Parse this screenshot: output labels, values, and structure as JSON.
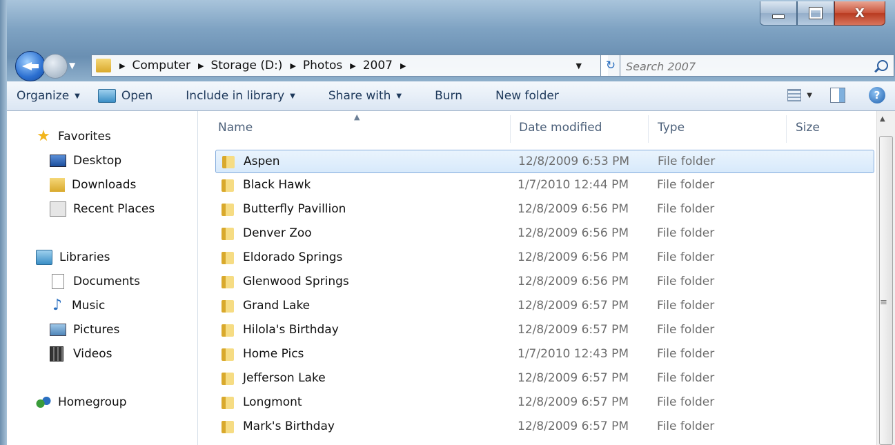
{
  "window": {
    "caption_buttons": [
      "minimize-icon",
      "maximize-icon",
      "close-icon"
    ],
    "close_glyph": "X"
  },
  "address": {
    "crumbs": [
      "Computer",
      "Storage (D:)",
      "Photos",
      "2007"
    ],
    "search_placeholder": "Search 2007"
  },
  "toolbar": {
    "organize": "Organize",
    "open": "Open",
    "include": "Include in library",
    "share": "Share with",
    "burn": "Burn",
    "new_folder": "New folder"
  },
  "nav": {
    "favorites": "Favorites",
    "desktop": "Desktop",
    "downloads": "Downloads",
    "recent": "Recent Places",
    "libraries": "Libraries",
    "documents": "Documents",
    "music": "Music",
    "pictures": "Pictures",
    "videos": "Videos",
    "homegroup": "Homegroup"
  },
  "columns": {
    "name": "Name",
    "date": "Date modified",
    "type": "Type",
    "size": "Size"
  },
  "files": [
    {
      "name": "Aspen",
      "date": "12/8/2009 6:53 PM",
      "type": "File folder"
    },
    {
      "name": "Black Hawk",
      "date": "1/7/2010 12:44 PM",
      "type": "File folder"
    },
    {
      "name": "Butterfly Pavillion",
      "date": "12/8/2009 6:56 PM",
      "type": "File folder"
    },
    {
      "name": "Denver Zoo",
      "date": "12/8/2009 6:56 PM",
      "type": "File folder"
    },
    {
      "name": "Eldorado Springs",
      "date": "12/8/2009 6:56 PM",
      "type": "File folder"
    },
    {
      "name": "Glenwood Springs",
      "date": "12/8/2009 6:56 PM",
      "type": "File folder"
    },
    {
      "name": "Grand Lake",
      "date": "12/8/2009 6:57 PM",
      "type": "File folder"
    },
    {
      "name": "Hilola's Birthday",
      "date": "12/8/2009 6:57 PM",
      "type": "File folder"
    },
    {
      "name": "Home Pics",
      "date": "1/7/2010 12:43 PM",
      "type": "File folder"
    },
    {
      "name": "Jefferson Lake",
      "date": "12/8/2009 6:57 PM",
      "type": "File folder"
    },
    {
      "name": "Longmont",
      "date": "12/8/2009 6:57 PM",
      "type": "File folder"
    },
    {
      "name": "Mark's Birthday",
      "date": "12/8/2009 6:57 PM",
      "type": "File folder"
    }
  ],
  "selected_index": 0,
  "colors": {
    "selection_fill": "#d7e9fb",
    "selection_border": "#84acdd",
    "header_text": "#4c607a"
  }
}
